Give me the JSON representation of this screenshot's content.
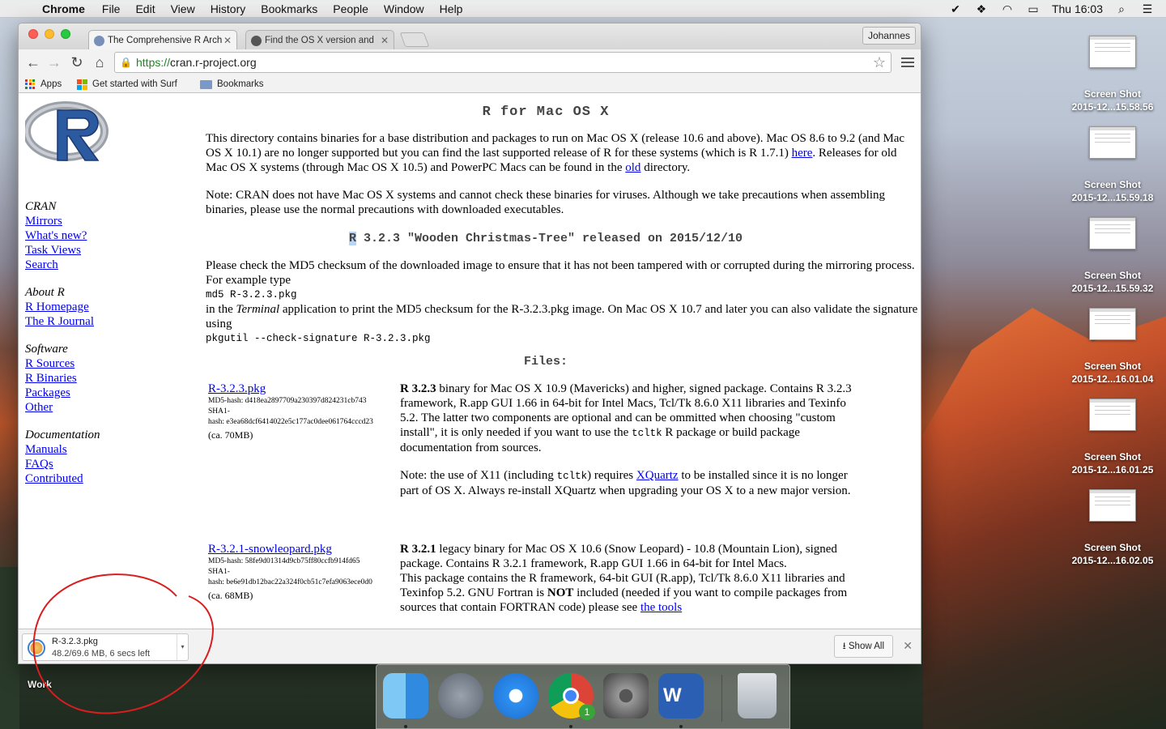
{
  "menubar": {
    "app": "Chrome",
    "items": [
      "File",
      "Edit",
      "View",
      "History",
      "Bookmarks",
      "People",
      "Window",
      "Help"
    ],
    "clock": "Thu 16:03"
  },
  "tabs": [
    {
      "title": "The Comprehensive R Arch"
    },
    {
      "title": "Find the OS X version and"
    }
  ],
  "profile": "Johannes",
  "omnibox": {
    "scheme": "https://",
    "host": "cran.r-project.org"
  },
  "bookmarks": {
    "apps": "Apps",
    "surf": "Get started with Surf",
    "folder": "Bookmarks"
  },
  "sidebar": {
    "cran": {
      "heading": "CRAN",
      "links": [
        "Mirrors",
        "What's new?",
        "Task Views",
        "Search"
      ]
    },
    "about": {
      "heading": "About R",
      "links": [
        "R Homepage",
        "The R Journal"
      ]
    },
    "software": {
      "heading": "Software",
      "links": [
        "R Sources",
        "R Binaries",
        "Packages",
        "Other"
      ]
    },
    "docs": {
      "heading": "Documentation",
      "links": [
        "Manuals",
        "FAQs",
        "Contributed"
      ]
    }
  },
  "main": {
    "title": "R for Mac OS X",
    "intro_1": "This directory contains binaries for a base distribution and packages to run on Mac OS X (release 10.6 and above). Mac OS 8.6 to 9.2 (and Mac OS X 10.1) are no longer supported but you can find the last supported release of R for these systems (which is R 1.7.1) ",
    "intro_here": "here",
    "intro_2": ". Releases for old Mac OS X systems (through Mac OS X 10.5) and PowerPC Macs can be found in the ",
    "intro_old": "old",
    "intro_3": " directory.",
    "note": "Note: CRAN does not have Mac OS X systems and cannot check these binaries for viruses. Although we take precautions when assembling binaries, please use the normal precautions with downloaded executables.",
    "release_r": "R",
    "release_rest": " 3.2.3 \"Wooden Christmas-Tree\" released on 2015/12/10",
    "check_1": "Please check the MD5 checksum of the downloaded image to ensure that it has not been tampered with or corrupted during the mirroring process. For example type",
    "md5_cmd": "md5 R-3.2.3.pkg",
    "check_2a": "in the ",
    "check_terminal": "Terminal",
    "check_2b": " application to print the MD5 checksum for the R-3.2.3.pkg image. On Mac OS X 10.7 and later you can also validate the signature using",
    "pkgutil_cmd": "pkgutil --check-signature R-3.2.3.pkg",
    "files_heading": "Files:",
    "files": [
      {
        "name": "R-3.2.3.pkg",
        "md5": "MD5-hash: d418ea2897709a230397d824231cb743",
        "sha1_label": "SHA1-",
        "sha1": "hash: e3ea68dcf6414022e5c177ac0dee061764cccd23",
        "size": "(ca. 70MB)",
        "desc_bold": "R 3.2.3",
        "desc_1": " binary for Mac OS X 10.9 (Mavericks) and higher, signed package. Contains R 3.2.3 framework, R.app GUI 1.66 in 64-bit for Intel Macs, Tcl/Tk 8.6.0 X11 libraries and Texinfo 5.2. The latter two components are optional and can be ommitted when choosing \"custom install\", it is only needed if you want to use the ",
        "desc_code": "tcltk",
        "desc_2": " R package or build package documentation from sources.",
        "note_1": "Note: the use of X11 (including ",
        "note_code": "tcltk",
        "note_2": ") requires ",
        "note_link": "XQuartz",
        "note_3": " to be installed since it is no longer part of OS X. Always re-install XQuartz when upgrading your OS X to a new major version."
      },
      {
        "name": "R-3.2.1-snowleopard.pkg",
        "md5": "MD5-hash: 58fe9d01314d9cb75ff80ccfb914fd65",
        "sha1_label": "SHA1-",
        "sha1": "hash: be6e91db12bac22a324f0cb51c7efa9063ece0d0",
        "size": "(ca. 68MB)",
        "desc_bold": "R 3.2.1",
        "desc_1": " legacy binary for Mac OS X 10.6 (Snow Leopard) - 10.8 (Mountain Lion), signed package. Contains R 3.2.1 framework, R.app GUI 1.66 in 64-bit for Intel Macs.",
        "desc_3a": "This package contains the R framework, 64-bit GUI (R.app), Tcl/Tk 8.6.0 X11 libraries and Texinfop 5.2. GNU Fortran is ",
        "desc_3_bold": "NOT",
        "desc_3b": " included (needed if you want to compile packages from sources that contain FORTRAN code) please see ",
        "desc_3_link": "the tools"
      }
    ]
  },
  "download": {
    "name": "R-3.2.3.pkg",
    "status": "48.2/69.6 MB, 6 secs left",
    "show_all": "Show All"
  },
  "desktop": {
    "icons": [
      {
        "label_1": "Screen Shot",
        "label_2": "2015-12...15.58.56"
      },
      {
        "label_1": "Screen Shot",
        "label_2": "2015-12...15.59.18"
      },
      {
        "label_1": "Screen Shot",
        "label_2": "2015-12...15.59.32"
      },
      {
        "label_1": "Screen Shot",
        "label_2": "2015-12...16.01.04"
      },
      {
        "label_1": "Screen Shot",
        "label_2": "2015-12...16.01.25"
      },
      {
        "label_1": "Screen Shot",
        "label_2": "2015-12...16.02.05"
      }
    ],
    "work_label": "Work"
  },
  "dock": {
    "chrome_badge": "1"
  },
  "colors": {
    "link": "#0000ee",
    "annotation": "#d81e1e"
  }
}
